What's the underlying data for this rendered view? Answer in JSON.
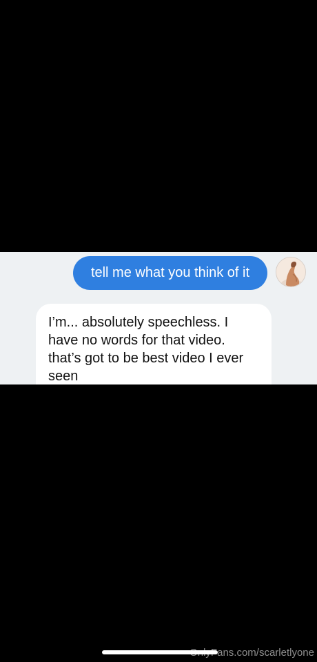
{
  "conversation": {
    "sent_message": "tell me what you think of it",
    "received_message": "I’m... absolutely speechless. I have no words for that video. that’s got to be best video I ever seen"
  },
  "avatar": {
    "icon": "user-avatar-photo"
  },
  "watermark": {
    "text": "OnlyFans.com/scarletlyone"
  },
  "colors": {
    "background": "#000000",
    "chat_background": "#eef1f3",
    "sent_bubble": "#2f7fe0",
    "received_bubble": "#ffffff"
  }
}
